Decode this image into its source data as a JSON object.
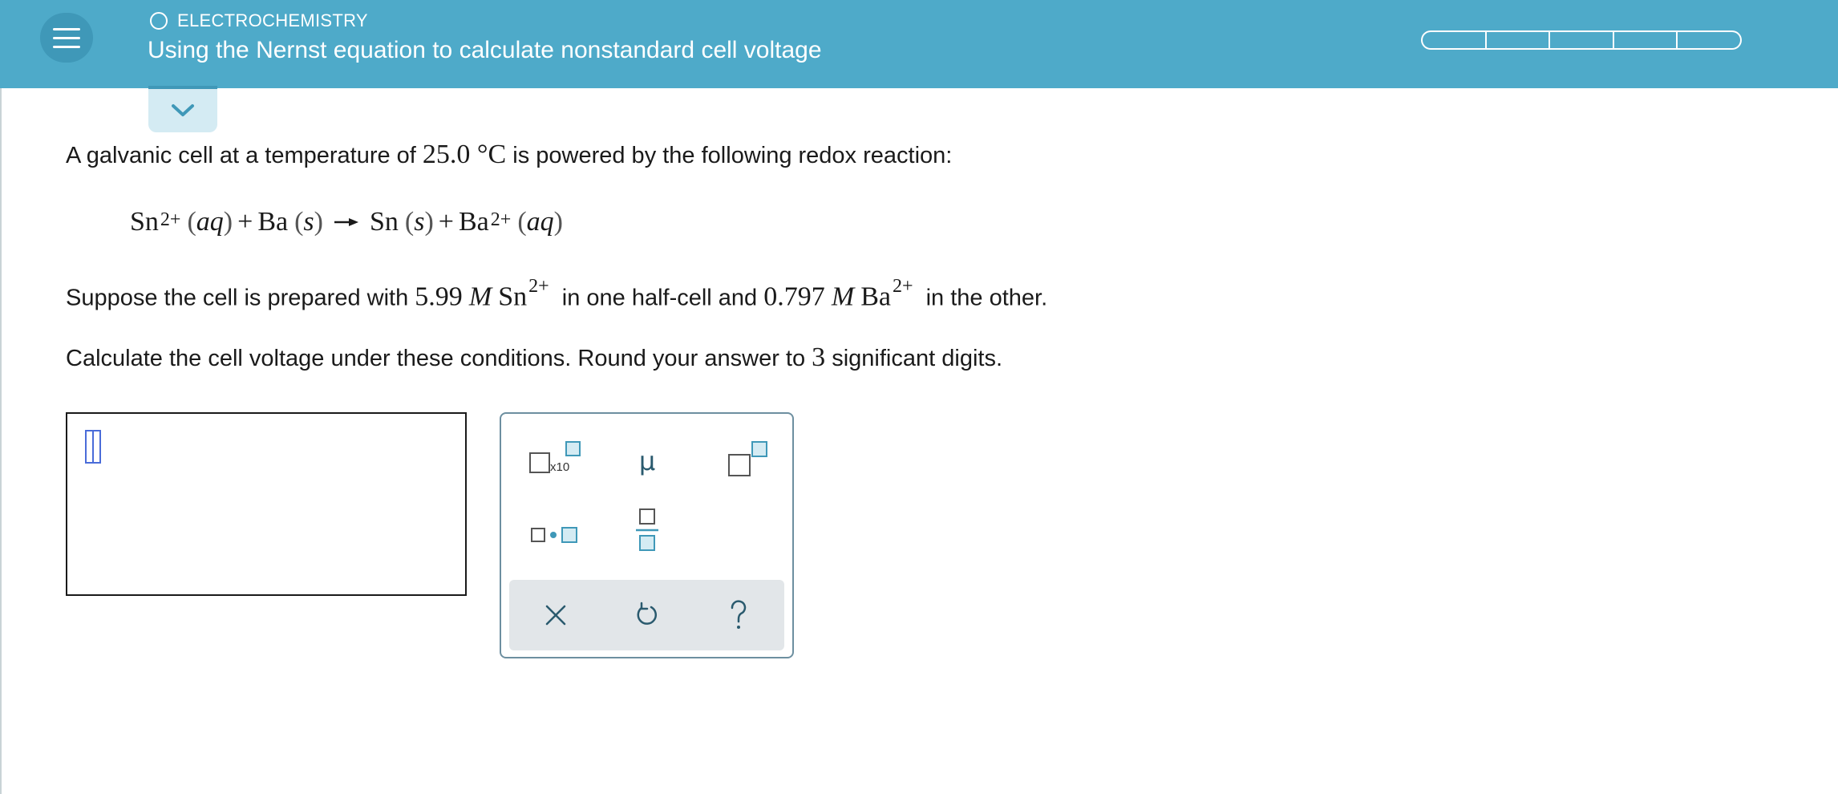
{
  "header": {
    "topic": "ELECTROCHEMISTRY",
    "title": "Using the Nernst equation to calculate nonstandard cell voltage",
    "progress_segments": 5
  },
  "problem": {
    "intro_before": "A galvanic cell at a temperature of ",
    "temperature": "25.0 °C",
    "intro_after": " is powered by the following redox reaction:",
    "reaction": {
      "reactant1": "Sn",
      "reactant1_charge": "2+",
      "state_aq": "aq",
      "plus": "+",
      "reactant2": "Ba",
      "state_s": "s",
      "product1": "Sn",
      "product2": "Ba",
      "product2_charge": "2+"
    },
    "prep_1": "Suppose the cell is prepared with ",
    "conc_sn": "5.99",
    "molar": "M",
    "sn": "Sn",
    "sn_charge": "2+",
    "prep_2": " in one half-cell and ",
    "conc_ba": "0.797",
    "ba": "Ba",
    "ba_charge": "2+",
    "prep_3": " in the other.",
    "calc_1": "Calculate the cell voltage under these conditions. Round your answer to ",
    "sig_digits": "3",
    "calc_2": " significant digits."
  },
  "palette": {
    "x10_label": "x10",
    "mu_label": "μ"
  },
  "colors": {
    "header_bg": "#4eaac9",
    "accent_dark": "#3f98b8",
    "tab_bg": "#d4ebf3",
    "palette_border": "#6d8fa0",
    "palette_footer": "#e2e6e9",
    "cursor": "#4a6cd9"
  },
  "icons": {
    "menu": "hamburger-icon",
    "topic": "circle-outline-icon",
    "collapse": "chevron-down-icon",
    "clear": "close-icon",
    "undo": "undo-icon",
    "help": "question-mark-icon"
  }
}
